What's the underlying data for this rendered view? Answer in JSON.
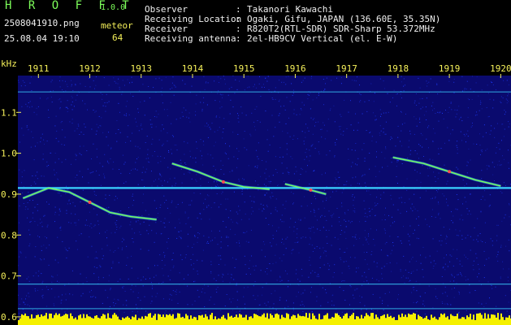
{
  "header": {
    "app_title": "H R O F F T",
    "app_version": "1.0.0",
    "file_name": "2508041910.png",
    "timestamp": "25.08.04 19:10",
    "type_label": "meteor",
    "count": "64",
    "info": [
      {
        "key": "Observer",
        "value": "Takanori Kawachi"
      },
      {
        "key": "Receiving Location",
        "value": "Ogaki, Gifu, JAPAN (136.60E, 35.35N)"
      },
      {
        "key": "Receiver",
        "value": "R820T2(RTL-SDR) SDR-Sharp 53.372MHz"
      },
      {
        "key": "Receiving antenna",
        "value": "2el-HB9CV Vertical (el. E-W)"
      }
    ],
    "separator": ":"
  },
  "chart_data": {
    "type": "heatmap",
    "ylabel": "kHz",
    "x_ticks": [
      "1911",
      "1912",
      "1913",
      "1914",
      "1915",
      "1916",
      "1917",
      "1918",
      "1919",
      "1920"
    ],
    "y_ticks": [
      1.1,
      1.0,
      0.9,
      0.8,
      0.7,
      0.6
    ],
    "y_range": [
      0.58,
      1.19
    ],
    "x_range_minutes": [
      10.6,
      20.2
    ],
    "carrier_lines_khz": [
      1.15,
      0.915,
      0.68,
      0.62
    ],
    "meteor_traces": [
      {
        "points": [
          [
            10.7,
            0.89
          ],
          [
            11.2,
            0.915
          ],
          [
            11.6,
            0.905
          ],
          [
            12.0,
            0.88
          ],
          [
            12.4,
            0.855
          ],
          [
            12.8,
            0.845
          ],
          [
            13.3,
            0.838
          ]
        ]
      },
      {
        "points": [
          [
            13.6,
            0.975
          ],
          [
            14.1,
            0.955
          ],
          [
            14.6,
            0.93
          ],
          [
            15.0,
            0.918
          ],
          [
            15.5,
            0.912
          ]
        ]
      },
      {
        "points": [
          [
            15.8,
            0.925
          ],
          [
            16.3,
            0.91
          ],
          [
            16.6,
            0.9
          ]
        ]
      },
      {
        "points": [
          [
            17.9,
            0.99
          ],
          [
            18.5,
            0.975
          ],
          [
            19.0,
            0.955
          ],
          [
            19.5,
            0.935
          ],
          [
            20.0,
            0.92
          ]
        ]
      }
    ],
    "colors": {
      "background": "#0a0a6e",
      "noise": "#1e3cff",
      "carrier": "#3ad1ff",
      "trace": "#7cfc5a",
      "trace_hot": "#ff5050",
      "axis_text": "#f5f05a",
      "tick": "#f5f05a",
      "level": "#f5f000"
    }
  }
}
